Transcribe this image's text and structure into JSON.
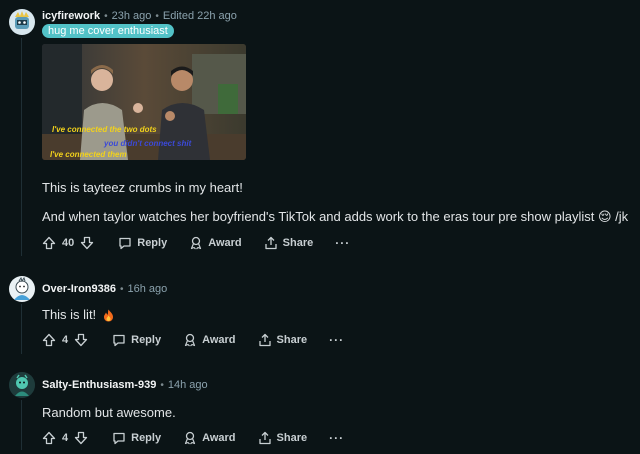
{
  "comments": [
    {
      "author": "icyfirework",
      "time": "23h ago",
      "edited": "Edited 22h ago",
      "flair": "hug me cover enthusiast",
      "media": {
        "caption_1": "I've connected the two dots",
        "caption_2": "you didn't connect shit",
        "caption_3": "I've connected them"
      },
      "paragraphs": [
        "This is tayteez crumbs in my heart!",
        "And when taylor watches her boyfriend's TikTok and adds work to the eras tour pre show playlist 😌 /jk"
      ],
      "votes": "40",
      "reply_label": "Reply",
      "award_label": "Award",
      "share_label": "Share",
      "more_label": "···"
    },
    {
      "author": "Over-Iron9386",
      "time": "16h ago",
      "paragraphs": [
        "This is lit!"
      ],
      "votes": "4",
      "reply_label": "Reply",
      "award_label": "Award",
      "share_label": "Share",
      "more_label": "···"
    },
    {
      "author": "Salty-Enthusiasm-939",
      "time": "14h ago",
      "paragraphs": [
        "Random but awesome."
      ],
      "votes": "4",
      "reply_label": "Reply",
      "award_label": "Award",
      "share_label": "Share",
      "more_label": "···"
    }
  ],
  "colors": {
    "background": "#0b1416",
    "flair": "#52c2c7",
    "caption_yellow": "#f2d21b",
    "caption_blue": "#3b49d8"
  }
}
